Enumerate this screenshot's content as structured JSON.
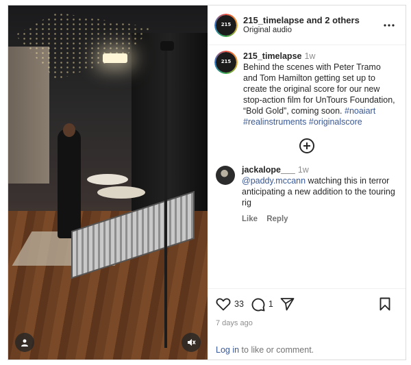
{
  "post": {
    "header": {
      "title": "215_timelapse and 2 others",
      "subtitle": "Original audio"
    },
    "caption": {
      "username": "215_timelapse",
      "time": "1w",
      "text": "Behind the scenes with Peter Tramo and Tom Hamilton getting set up to create the original score for our new stop-action film for UnTours Foundation, “Bold Gold”, coming soon.",
      "hashtags": [
        "#noaiart",
        "#realinstruments",
        "#originalscore"
      ]
    },
    "comment": {
      "username": "jackalope___",
      "time": "1w",
      "mention": "@paddy.mccann",
      "text": "watching this in terror anticipating a new addition to the touring rig",
      "like_label": "Like",
      "reply_label": "Reply"
    },
    "footer": {
      "like_count": "33",
      "comment_count": "1",
      "date": "7 days ago",
      "login_link": "Log in",
      "login_rest": "to like or comment."
    }
  },
  "icons": {
    "more": "more-options-icon",
    "add_comment": "plus-circle-icon",
    "like": "heart-icon",
    "comment": "comment-bubble-icon",
    "share": "send-icon",
    "save": "bookmark-icon",
    "tagged": "user-tag-icon",
    "mute": "speaker-muted-icon"
  },
  "colors": {
    "link": "#385898",
    "secondary_text": "#8e8e8e",
    "border": "#dbdbdb"
  }
}
